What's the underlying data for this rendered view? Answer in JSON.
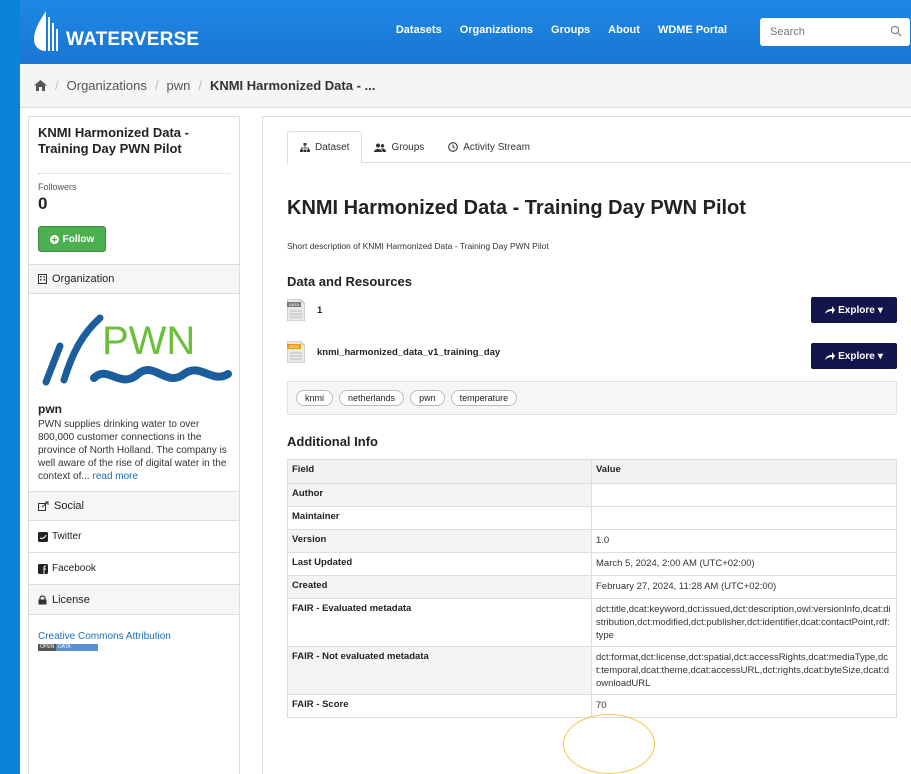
{
  "header": {
    "brand": "WATERVERSE",
    "nav": [
      "Datasets",
      "Organizations",
      "Groups",
      "About",
      "WDME Portal"
    ],
    "search_placeholder": "Search"
  },
  "breadcrumb": {
    "items": [
      "Organizations",
      "pwn"
    ],
    "current": "KNMI Harmonized Data - ..."
  },
  "sidebar": {
    "title": "KNMI Harmonized Data - Training Day PWN Pilot",
    "followers_label": "Followers",
    "followers_count": "0",
    "follow_button": "Follow",
    "organization_heading": "Organization",
    "org_logo_text": "PWN",
    "org_name": "pwn",
    "org_description": "PWN supplies drinking water to over 800,000 customer connections in the province of North Holland. The company is well aware of the rise of digital water in the context of...",
    "read_more": "read more",
    "social_heading": "Social",
    "social_items": [
      "Twitter",
      "Facebook"
    ],
    "license_heading": "License",
    "license_link": "Creative Commons Attribution",
    "open_data_badge": [
      "OPEN",
      "DATA"
    ]
  },
  "tabs": [
    {
      "label": "Dataset",
      "active": true
    },
    {
      "label": "Groups",
      "active": false
    },
    {
      "label": "Activity Stream",
      "active": false
    }
  ],
  "dataset": {
    "title": "KNMI Harmonized Data - Training Day PWN Pilot",
    "short_description": "Short description of KNMI Harmonized Data - Training Day PWN Pilot",
    "resources_heading": "Data and Resources",
    "resources": [
      {
        "format": "DATA",
        "name": "1",
        "button": "Explore"
      },
      {
        "format": "JSON",
        "name": "knmi_harmonized_data_v1_training_day",
        "button": "Explore"
      }
    ],
    "tags": [
      "knmi",
      "netherlands",
      "pwn",
      "temperature"
    ]
  },
  "additional_info": {
    "heading": "Additional Info",
    "columns": [
      "Field",
      "Value"
    ],
    "rows": [
      {
        "field": "Author",
        "value": ""
      },
      {
        "field": "Maintainer",
        "value": ""
      },
      {
        "field": "Version",
        "value": "1.0"
      },
      {
        "field": "Last Updated",
        "value": "March 5, 2024, 2:00 AM (UTC+02:00)"
      },
      {
        "field": "Created",
        "value": "February 27, 2024, 11:28 AM (UTC+02:00)"
      },
      {
        "field": "FAIR - Evaluated metadata",
        "value": "dct:title,dcat:keyword,dct:issued,dct:description,owl:versionInfo,dcat:distribution,dct:modified,dct:publisher,dct:identifier,dcat:contactPoint,rdf:type"
      },
      {
        "field": "FAIR - Not evaluated metadata",
        "value": "dct:format,dct:license,dct:spatial,dct:accessRights,dcat:mediaType,dct:temporal,dcat:theme,dcat:accessURL,dct:rights,dcat:byteSize,dcat:downloadURL"
      },
      {
        "field": "FAIR - Score",
        "value": "70"
      }
    ]
  },
  "colors": {
    "header": "#1976d2",
    "explore_button": "#15154d",
    "follow_button": "#4caf50",
    "annotation_circle": "#f4c64a"
  }
}
